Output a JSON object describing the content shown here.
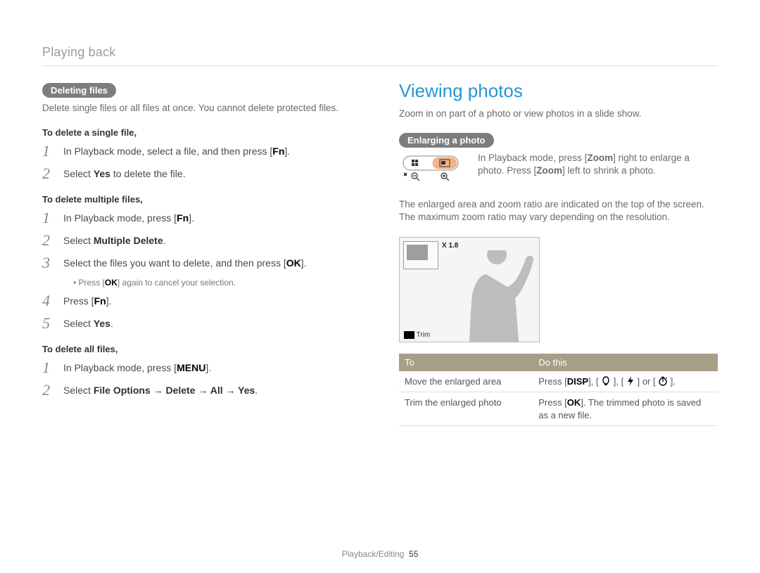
{
  "breadcrumb": "Playing back",
  "left": {
    "pill1": "Deleting files",
    "intro": "Delete single files or all files at once. You cannot delete protected files.",
    "sub1": "To delete a single file,",
    "s1_1a": "In Playback mode, select a file, and then press [",
    "s1_1b": "Fn",
    "s1_1c": "].",
    "s1_2a": "Select ",
    "s1_2b": "Yes",
    "s1_2c": " to delete the file.",
    "sub2": "To delete multiple files,",
    "s2_1a": "In Playback mode, press [",
    "s2_1b": "Fn",
    "s2_1c": "].",
    "s2_2a": "Select ",
    "s2_2b": "Multiple Delete",
    "s2_2c": ".",
    "s2_3a": "Select the files you want to delete, and then press [",
    "s2_3b": "OK",
    "s2_3c": "].",
    "s2_3bullet_a": "Press [",
    "s2_3bullet_b": "OK",
    "s2_3bullet_c": "] again to cancel your selection.",
    "s2_4a": "Press [",
    "s2_4b": "Fn",
    "s2_4c": "].",
    "s2_5a": "Select ",
    "s2_5b": "Yes",
    "s2_5c": ".",
    "sub3": "To delete all files,",
    "s3_1a": "In Playback mode, press [",
    "s3_1b": "MENU",
    "s3_1c": "].",
    "s3_2a": "Select ",
    "s3_2b": "File Options → Delete → All → Yes",
    "s3_2c": "."
  },
  "right": {
    "h2": "Viewing photos",
    "intro": "Zoom in on part of a photo or view photos in a slide show.",
    "pill1": "Enlarging a photo",
    "zoom_a": "In Playback mode, press [",
    "zoom_b": "Zoom",
    "zoom_c": "] right to enlarge a photo. Press [",
    "zoom_d": "Zoom",
    "zoom_e": "] left to shrink a photo.",
    "para2": "The enlarged area and zoom ratio are indicated on the top of the screen. The maximum zoom ratio may vary depending on the resolution.",
    "zoomratio": "X 1.8",
    "trim_ok": "OK",
    "trim_label": " Trim",
    "table": {
      "th1": "To",
      "th2": "Do this",
      "row1_to": "Move the enlarged area",
      "row1_do_a": "Press [",
      "row1_do_b": "DISP",
      "row1_do_c": "], [",
      "row1_do_d": "], [",
      "row1_do_e": "] or [",
      "row1_do_f": "].",
      "row2_to": "Trim the enlarged photo",
      "row2_do_a": "Press [",
      "row2_do_b": "OK",
      "row2_do_c": "]. The trimmed photo is saved as a new file."
    }
  },
  "footer": {
    "section": "Playback/Editing",
    "page": "55"
  }
}
